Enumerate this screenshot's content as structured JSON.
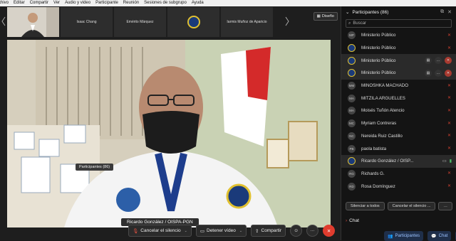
{
  "menu": [
    "chivo",
    "Editar",
    "Compartir",
    "Ver",
    "Audio y video",
    "Participante",
    "Reunión",
    "Sesiones de subgrupo",
    "Ayuda"
  ],
  "thumbnails": [
    {
      "name": "",
      "kind": "video"
    },
    {
      "name": "Isaac Chang",
      "kind": "name"
    },
    {
      "name": "Emérito Márquez",
      "kind": "name"
    },
    {
      "name": "",
      "kind": "logo"
    },
    {
      "name": "Iarmis Muñoz de Aparicio",
      "kind": "name"
    }
  ],
  "layout_button": "Diseño",
  "active_speaker": "Ricardo González / OISPA-PGN",
  "toolbar": {
    "mute": "Cancelar el silencio",
    "video": "Detener vídeo",
    "share": "Compartir"
  },
  "panel": {
    "title": "Participantes (86)",
    "search_placeholder": "Buscar",
    "tooltip": "Participantes (86)",
    "participants": [
      {
        "initials": "MP",
        "name": "Ministerio Público",
        "logo": false,
        "highlight": false
      },
      {
        "initials": "",
        "name": "Ministerio Público",
        "logo": true,
        "highlight": false
      },
      {
        "initials": "",
        "name": "Ministerio Público",
        "logo": true,
        "highlight": true
      },
      {
        "initials": "",
        "name": "Ministerio Público",
        "logo": true,
        "highlight": true
      },
      {
        "initials": "MM",
        "name": "MINOSHKA MACHADO",
        "logo": false,
        "highlight": false
      },
      {
        "initials": "MA",
        "name": "MITZILA ARGUELLES",
        "logo": false,
        "highlight": false
      },
      {
        "initials": "MA",
        "name": "Moisés Tuñón Atencio",
        "logo": false,
        "highlight": false
      },
      {
        "initials": "MC",
        "name": "Myriam Contreras",
        "logo": false,
        "highlight": false
      },
      {
        "initials": "NC",
        "name": "Nereida Ruiz Castillo",
        "logo": false,
        "highlight": false
      },
      {
        "initials": "PB",
        "name": "paola batista",
        "logo": false,
        "highlight": false
      },
      {
        "initials": "",
        "name": "Ricardo González / OISP...",
        "logo": true,
        "highlight": true
      },
      {
        "initials": "RG",
        "name": "Richards G.",
        "logo": false,
        "highlight": false
      },
      {
        "initials": "RD",
        "name": "Rosa Domínguez",
        "logo": false,
        "highlight": false
      }
    ],
    "mute_all": "Silenciar a todos",
    "unmute_all": "Cancelar el silencio ...",
    "chat_header": "Chat",
    "tab_participants": "Participantes",
    "tab_chat": "Chat"
  },
  "colors": {
    "end_call": "#e03c2e",
    "accent": "#9cc3ff",
    "logo_blue": "#1a3a7a",
    "logo_gold": "#e0c030"
  }
}
